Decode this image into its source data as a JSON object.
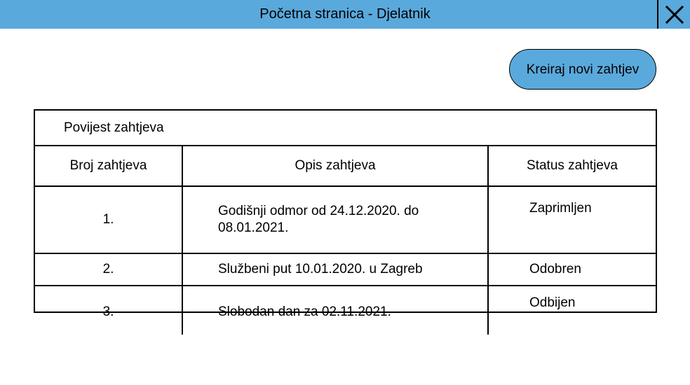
{
  "window": {
    "title": "Početna stranica - Djelatnik",
    "close_icon": "close-icon",
    "accent_color": "#5aa9dc"
  },
  "actions": {
    "create_request_label": "Kreiraj novi zahtjev"
  },
  "history": {
    "caption": "Povijest zahtjeva",
    "columns": [
      "Broj zahtjeva",
      "Opis zahtjeva",
      "Status zahtjeva"
    ],
    "rows": [
      {
        "number": "1.",
        "description": "Godišnji odmor od 24.12.2020. do 08.01.2021.",
        "status": "Zaprimljen"
      },
      {
        "number": "2.",
        "description": "Službeni put 10.01.2020. u Zagreb",
        "status": "Odobren"
      },
      {
        "number": "3.",
        "description": "Slobodan dan za 02.11.2021.",
        "status": "Odbijen"
      }
    ]
  }
}
